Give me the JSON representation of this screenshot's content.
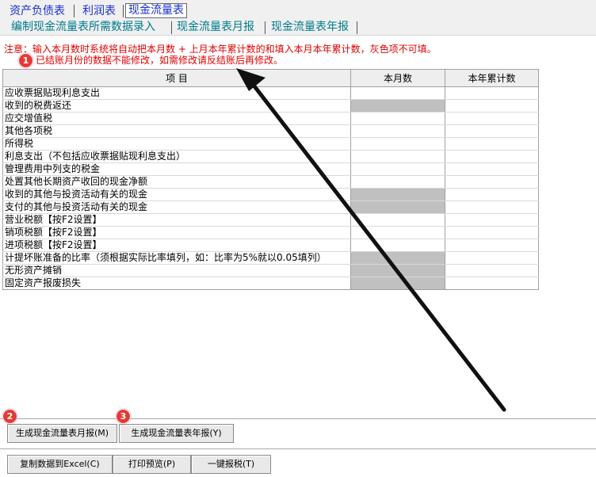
{
  "tabs": [
    "资产负债表",
    "利润表",
    "现金流量表"
  ],
  "subtabs": [
    "编制现金流量表所需数据录入",
    "现金流量表月报",
    "现金流量表年报"
  ],
  "notice": {
    "line1": "注意：输入本月数时系统将自动把本月数 + 上月本年累计数的和填入本月本年累计数，灰色项不可填。",
    "line2": "已结账月份的数据不能修改，如需修改请反结账后再修改。"
  },
  "badges": [
    "1",
    "2",
    "3"
  ],
  "table": {
    "headers": [
      "项    目",
      "本月数",
      "本年累计数"
    ],
    "rows": [
      {
        "item": "应收票据贴现利息支出",
        "gray": false
      },
      {
        "item": "收到的税费返还",
        "gray": true
      },
      {
        "item": "应交增值税",
        "gray": false
      },
      {
        "item": "其他各项税",
        "gray": false
      },
      {
        "item": "所得税",
        "gray": false
      },
      {
        "item": "利息支出（不包括应收票据贴现利息支出）",
        "gray": false
      },
      {
        "item": "管理费用中列支的税金",
        "gray": false
      },
      {
        "item": "处置其他长期资产收回的现金净额",
        "gray": false
      },
      {
        "item": "收到的其他与投资活动有关的现金",
        "gray": true
      },
      {
        "item": "支付的其他与投资活动有关的现金",
        "gray": true
      },
      {
        "item": "营业税额【按F2设置】",
        "gray": false
      },
      {
        "item": "销项税额【按F2设置】",
        "gray": false
      },
      {
        "item": "进项税额【按F2设置】",
        "gray": false
      },
      {
        "item": "计提坏账准备的比率（须根据实际比率填列，如：比率为5%就以0.05填列）",
        "gray": true
      },
      {
        "item": "无形资产摊销",
        "gray": true
      },
      {
        "item": "固定资产报废损失",
        "gray": true
      }
    ]
  },
  "buttons": {
    "gen_monthly": "生成现金流量表月报(M)",
    "gen_yearly": "生成现金流量表年报(Y)",
    "copy_excel": "复制数据到Excel(C)",
    "print_preview": "打印预览(P)",
    "one_click_tax": "一键报税(T)"
  },
  "colors": {
    "tab_text": "#1a2fd0",
    "subtab_text": "#007a8a",
    "notice_text": "#e00000",
    "gray_cell": "#c0c0c0",
    "badge": "#e53935"
  }
}
